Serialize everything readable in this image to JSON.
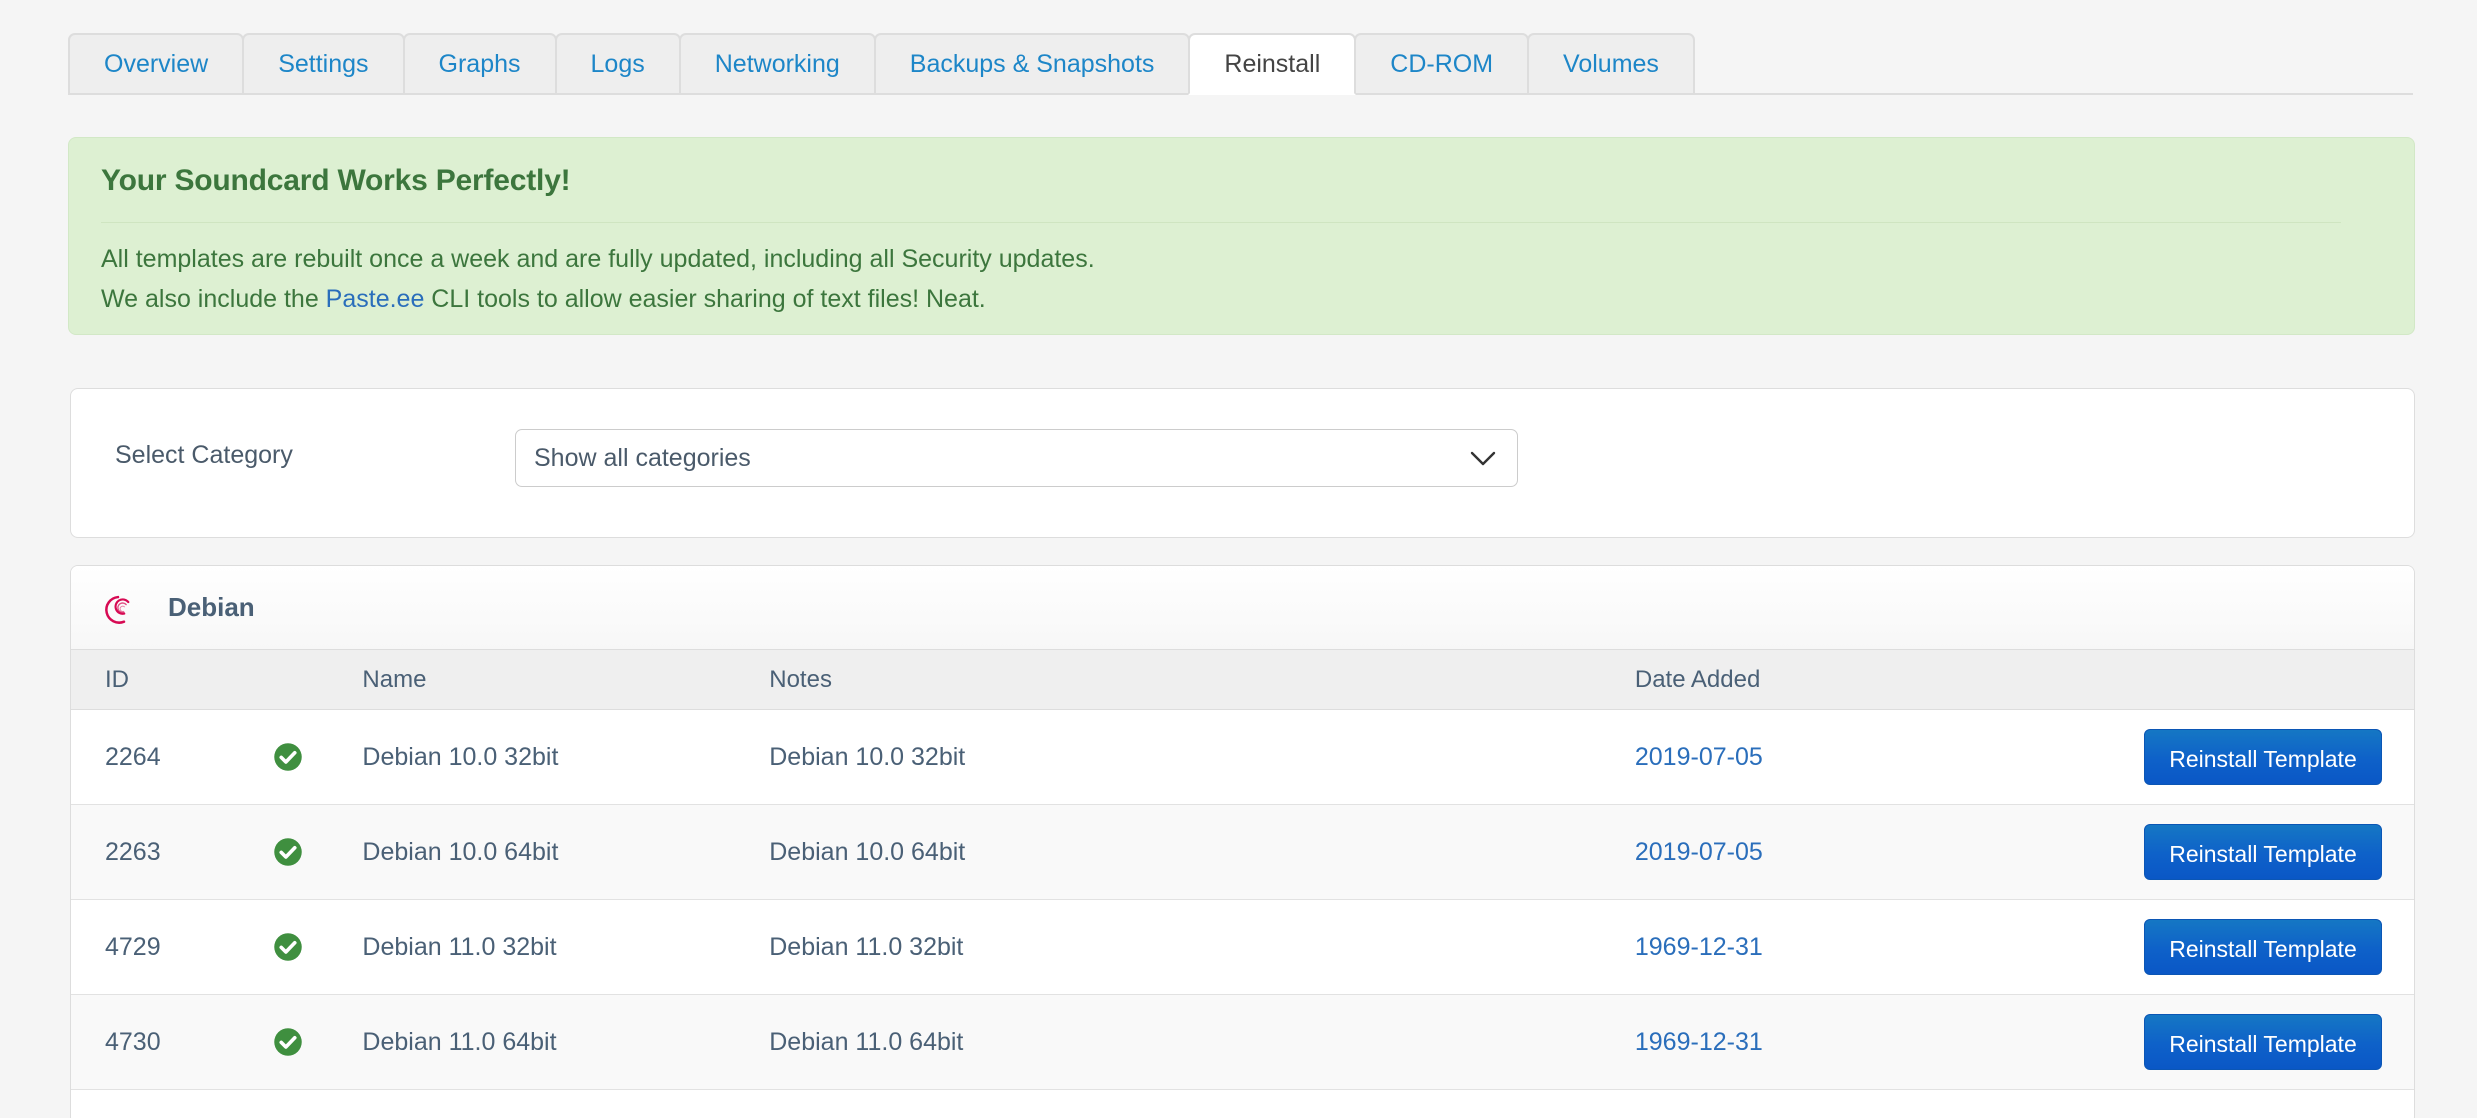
{
  "tabs": [
    {
      "label": "Overview",
      "active": false
    },
    {
      "label": "Settings",
      "active": false
    },
    {
      "label": "Graphs",
      "active": false
    },
    {
      "label": "Logs",
      "active": false
    },
    {
      "label": "Networking",
      "active": false
    },
    {
      "label": "Backups & Snapshots",
      "active": false
    },
    {
      "label": "Reinstall",
      "active": true
    },
    {
      "label": "CD-ROM",
      "active": false
    },
    {
      "label": "Volumes",
      "active": false
    }
  ],
  "alert": {
    "title": "Your Soundcard Works Perfectly!",
    "line1": "All templates are rebuilt once a week and are fully updated, including all Security updates.",
    "line2_before": "We also include the ",
    "line2_link": "Paste.ee",
    "line2_after": " CLI tools to allow easier sharing of text files! Neat.",
    "bg_color": "#ddf0d2",
    "text_color": "#3c763d",
    "link_color": "#2a6ebb"
  },
  "category": {
    "label": "Select Category",
    "selected": "Show all categories",
    "options": [
      "Show all categories"
    ],
    "chevron_icon": "chevron-down-icon"
  },
  "template_group": {
    "os_name": "Debian",
    "os_logo_icon": "debian-swirl-logo-icon",
    "logo_color": "#d70a53",
    "columns": [
      "ID",
      "",
      "Name",
      "Notes",
      "Date Added",
      ""
    ],
    "action_label": "Reinstall Template",
    "status_icon": "check-circle-icon",
    "status_color": "#3f8f3f",
    "rows": [
      {
        "id": "2264",
        "name": "Debian 10.0 32bit",
        "notes": "Debian 10.0 32bit",
        "date": "2019-07-05"
      },
      {
        "id": "2263",
        "name": "Debian 10.0 64bit",
        "notes": "Debian 10.0 64bit",
        "date": "2019-07-05"
      },
      {
        "id": "4729",
        "name": "Debian 11.0 32bit",
        "notes": "Debian 11.0 32bit",
        "date": "1969-12-31"
      },
      {
        "id": "4730",
        "name": "Debian 11.0 64bit",
        "notes": "Debian 11.0 64bit",
        "date": "1969-12-31"
      }
    ]
  },
  "theme": {
    "page_bg": "#f5f5f5",
    "tab_link_color": "#1d86c8",
    "button_blue": "#0e61c9",
    "heading_color": "#4a6076"
  }
}
